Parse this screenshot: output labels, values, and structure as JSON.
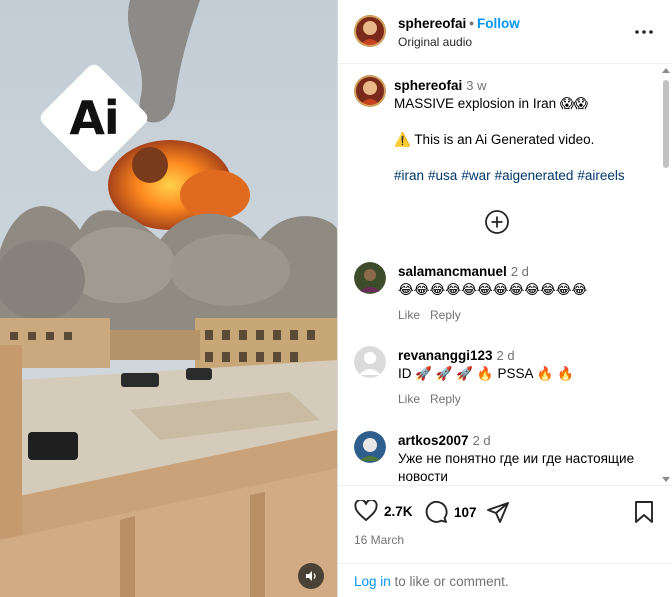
{
  "post": {
    "username": "sphereofai",
    "follow_label": "Follow",
    "separator": "•",
    "audio": "Original audio",
    "badge_text": "Ai"
  },
  "caption": {
    "username": "sphereofai",
    "time": "3 w",
    "line1": "MASSIVE explosion in Iran 😱😱",
    "line2": "⚠️ This is an Ai Generated video.",
    "hashtags": [
      "#iran",
      "#usa",
      "#war",
      "#aigenerated",
      "#aireels"
    ]
  },
  "comments": [
    {
      "username": "salamancmanuel",
      "time": "2 d",
      "text": "😂😂😂😂😂😂😂😂😂😂😂😂",
      "like_label": "Like",
      "reply_label": "Reply",
      "avatar_color": "#3d4c2a"
    },
    {
      "username": "revananggi123",
      "time": "2 d",
      "text": "ID 🚀 🚀 🚀 🔥 PSSA 🔥 🔥",
      "like_label": "Like",
      "reply_label": "Reply",
      "avatar_color": "#c7c7c7"
    },
    {
      "username": "artkos2007",
      "time": "2 d",
      "text": "Уже не понятно где ии где настоящие новости",
      "like_label": "",
      "reply_label": "",
      "avatar_color": "#2f5e8c"
    }
  ],
  "actions": {
    "likes": "2.7K",
    "comments": "107",
    "date": "16 March"
  },
  "login": {
    "link": "Log in",
    "rest": " to like or comment."
  },
  "icons": {
    "more": "more-options-icon",
    "like": "heart-icon",
    "comment": "comment-icon",
    "share": "share-icon",
    "save": "bookmark-icon",
    "load_more": "add-circle-icon",
    "mute": "volume-icon"
  }
}
